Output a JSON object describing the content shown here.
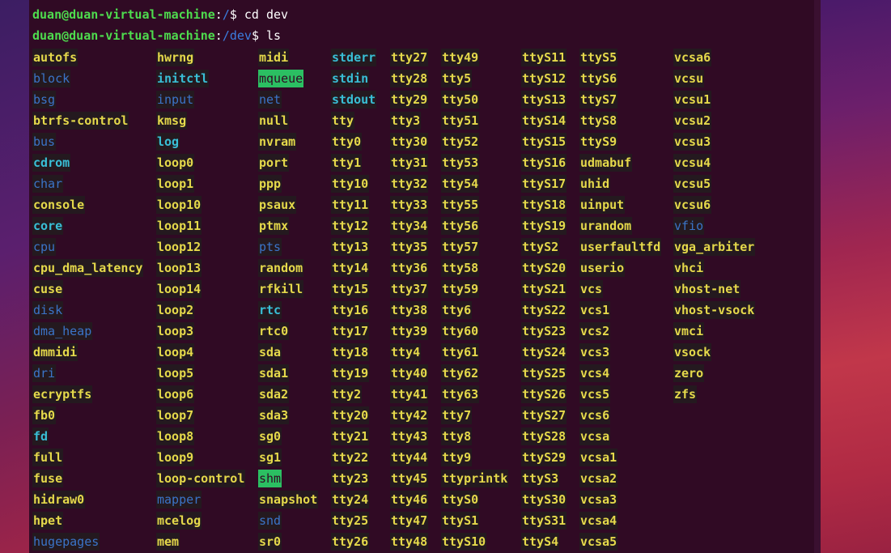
{
  "prompt": {
    "user_host": "duan@duan-virtual-machine",
    "line1_path": "/",
    "line1_cmd": "$ cd dev",
    "line2_path": "/dev",
    "line2_cmd": "$ ls"
  },
  "colors": {
    "terminal_bg": "#300a24",
    "char_device": "#e5d94b",
    "directory": "#3b74c8",
    "symlink": "#39bfd6",
    "sticky_dir_bg": "#2bbf62",
    "prompt_user": "#4edc4e",
    "prompt_path": "#3b7de0"
  },
  "listing": {
    "columns": [
      [
        {
          "name": "autofs",
          "type": "chr"
        },
        {
          "name": "block",
          "type": "dir"
        },
        {
          "name": "bsg",
          "type": "dir"
        },
        {
          "name": "btrfs-control",
          "type": "chr"
        },
        {
          "name": "bus",
          "type": "dir"
        },
        {
          "name": "cdrom",
          "type": "lnk"
        },
        {
          "name": "char",
          "type": "dir"
        },
        {
          "name": "console",
          "type": "chr"
        },
        {
          "name": "core",
          "type": "lnk"
        },
        {
          "name": "cpu",
          "type": "dir"
        },
        {
          "name": "cpu_dma_latency",
          "type": "chr"
        },
        {
          "name": "cuse",
          "type": "chr"
        },
        {
          "name": "disk",
          "type": "dir"
        },
        {
          "name": "dma_heap",
          "type": "dir"
        },
        {
          "name": "dmmidi",
          "type": "chr"
        },
        {
          "name": "dri",
          "type": "dir"
        },
        {
          "name": "ecryptfs",
          "type": "chr"
        },
        {
          "name": "fb0",
          "type": "chr"
        },
        {
          "name": "fd",
          "type": "lnk"
        },
        {
          "name": "full",
          "type": "chr"
        },
        {
          "name": "fuse",
          "type": "chr"
        },
        {
          "name": "hidraw0",
          "type": "chr"
        },
        {
          "name": "hpet",
          "type": "chr"
        },
        {
          "name": "hugepages",
          "type": "dir"
        }
      ],
      [
        {
          "name": "hwrng",
          "type": "chr"
        },
        {
          "name": "initctl",
          "type": "lnk"
        },
        {
          "name": "input",
          "type": "dir"
        },
        {
          "name": "kmsg",
          "type": "chr"
        },
        {
          "name": "log",
          "type": "lnk"
        },
        {
          "name": "loop0",
          "type": "chr"
        },
        {
          "name": "loop1",
          "type": "chr"
        },
        {
          "name": "loop10",
          "type": "chr"
        },
        {
          "name": "loop11",
          "type": "chr"
        },
        {
          "name": "loop12",
          "type": "chr"
        },
        {
          "name": "loop13",
          "type": "chr"
        },
        {
          "name": "loop14",
          "type": "chr"
        },
        {
          "name": "loop2",
          "type": "chr"
        },
        {
          "name": "loop3",
          "type": "chr"
        },
        {
          "name": "loop4",
          "type": "chr"
        },
        {
          "name": "loop5",
          "type": "chr"
        },
        {
          "name": "loop6",
          "type": "chr"
        },
        {
          "name": "loop7",
          "type": "chr"
        },
        {
          "name": "loop8",
          "type": "chr"
        },
        {
          "name": "loop9",
          "type": "chr"
        },
        {
          "name": "loop-control",
          "type": "chr"
        },
        {
          "name": "mapper",
          "type": "dir"
        },
        {
          "name": "mcelog",
          "type": "chr"
        },
        {
          "name": "mem",
          "type": "chr"
        }
      ],
      [
        {
          "name": "midi",
          "type": "chr"
        },
        {
          "name": "mqueue",
          "type": "sticky"
        },
        {
          "name": "net",
          "type": "dir"
        },
        {
          "name": "null",
          "type": "chr"
        },
        {
          "name": "nvram",
          "type": "chr"
        },
        {
          "name": "port",
          "type": "chr"
        },
        {
          "name": "ppp",
          "type": "chr"
        },
        {
          "name": "psaux",
          "type": "chr"
        },
        {
          "name": "ptmx",
          "type": "chr"
        },
        {
          "name": "pts",
          "type": "dir"
        },
        {
          "name": "random",
          "type": "chr"
        },
        {
          "name": "rfkill",
          "type": "chr"
        },
        {
          "name": "rtc",
          "type": "lnk"
        },
        {
          "name": "rtc0",
          "type": "chr"
        },
        {
          "name": "sda",
          "type": "chr"
        },
        {
          "name": "sda1",
          "type": "chr"
        },
        {
          "name": "sda2",
          "type": "chr"
        },
        {
          "name": "sda3",
          "type": "chr"
        },
        {
          "name": "sg0",
          "type": "chr"
        },
        {
          "name": "sg1",
          "type": "chr"
        },
        {
          "name": "shm",
          "type": "sticky"
        },
        {
          "name": "snapshot",
          "type": "chr"
        },
        {
          "name": "snd",
          "type": "dir"
        },
        {
          "name": "sr0",
          "type": "chr"
        }
      ],
      [
        {
          "name": "stderr",
          "type": "lnk"
        },
        {
          "name": "stdin",
          "type": "lnk"
        },
        {
          "name": "stdout",
          "type": "lnk"
        },
        {
          "name": "tty",
          "type": "chr"
        },
        {
          "name": "tty0",
          "type": "chr"
        },
        {
          "name": "tty1",
          "type": "chr"
        },
        {
          "name": "tty10",
          "type": "chr"
        },
        {
          "name": "tty11",
          "type": "chr"
        },
        {
          "name": "tty12",
          "type": "chr"
        },
        {
          "name": "tty13",
          "type": "chr"
        },
        {
          "name": "tty14",
          "type": "chr"
        },
        {
          "name": "tty15",
          "type": "chr"
        },
        {
          "name": "tty16",
          "type": "chr"
        },
        {
          "name": "tty17",
          "type": "chr"
        },
        {
          "name": "tty18",
          "type": "chr"
        },
        {
          "name": "tty19",
          "type": "chr"
        },
        {
          "name": "tty2",
          "type": "chr"
        },
        {
          "name": "tty20",
          "type": "chr"
        },
        {
          "name": "tty21",
          "type": "chr"
        },
        {
          "name": "tty22",
          "type": "chr"
        },
        {
          "name": "tty23",
          "type": "chr"
        },
        {
          "name": "tty24",
          "type": "chr"
        },
        {
          "name": "tty25",
          "type": "chr"
        },
        {
          "name": "tty26",
          "type": "chr"
        }
      ],
      [
        {
          "name": "tty27",
          "type": "chr"
        },
        {
          "name": "tty28",
          "type": "chr"
        },
        {
          "name": "tty29",
          "type": "chr"
        },
        {
          "name": "tty3",
          "type": "chr"
        },
        {
          "name": "tty30",
          "type": "chr"
        },
        {
          "name": "tty31",
          "type": "chr"
        },
        {
          "name": "tty32",
          "type": "chr"
        },
        {
          "name": "tty33",
          "type": "chr"
        },
        {
          "name": "tty34",
          "type": "chr"
        },
        {
          "name": "tty35",
          "type": "chr"
        },
        {
          "name": "tty36",
          "type": "chr"
        },
        {
          "name": "tty37",
          "type": "chr"
        },
        {
          "name": "tty38",
          "type": "chr"
        },
        {
          "name": "tty39",
          "type": "chr"
        },
        {
          "name": "tty4",
          "type": "chr"
        },
        {
          "name": "tty40",
          "type": "chr"
        },
        {
          "name": "tty41",
          "type": "chr"
        },
        {
          "name": "tty42",
          "type": "chr"
        },
        {
          "name": "tty43",
          "type": "chr"
        },
        {
          "name": "tty44",
          "type": "chr"
        },
        {
          "name": "tty45",
          "type": "chr"
        },
        {
          "name": "tty46",
          "type": "chr"
        },
        {
          "name": "tty47",
          "type": "chr"
        },
        {
          "name": "tty48",
          "type": "chr"
        }
      ],
      [
        {
          "name": "tty49",
          "type": "chr"
        },
        {
          "name": "tty5",
          "type": "chr"
        },
        {
          "name": "tty50",
          "type": "chr"
        },
        {
          "name": "tty51",
          "type": "chr"
        },
        {
          "name": "tty52",
          "type": "chr"
        },
        {
          "name": "tty53",
          "type": "chr"
        },
        {
          "name": "tty54",
          "type": "chr"
        },
        {
          "name": "tty55",
          "type": "chr"
        },
        {
          "name": "tty56",
          "type": "chr"
        },
        {
          "name": "tty57",
          "type": "chr"
        },
        {
          "name": "tty58",
          "type": "chr"
        },
        {
          "name": "tty59",
          "type": "chr"
        },
        {
          "name": "tty6",
          "type": "chr"
        },
        {
          "name": "tty60",
          "type": "chr"
        },
        {
          "name": "tty61",
          "type": "chr"
        },
        {
          "name": "tty62",
          "type": "chr"
        },
        {
          "name": "tty63",
          "type": "chr"
        },
        {
          "name": "tty7",
          "type": "chr"
        },
        {
          "name": "tty8",
          "type": "chr"
        },
        {
          "name": "tty9",
          "type": "chr"
        },
        {
          "name": "ttyprintk",
          "type": "chr"
        },
        {
          "name": "ttyS0",
          "type": "chr"
        },
        {
          "name": "ttyS1",
          "type": "chr"
        },
        {
          "name": "ttyS10",
          "type": "chr"
        }
      ],
      [
        {
          "name": "ttyS11",
          "type": "chr"
        },
        {
          "name": "ttyS12",
          "type": "chr"
        },
        {
          "name": "ttyS13",
          "type": "chr"
        },
        {
          "name": "ttyS14",
          "type": "chr"
        },
        {
          "name": "ttyS15",
          "type": "chr"
        },
        {
          "name": "ttyS16",
          "type": "chr"
        },
        {
          "name": "ttyS17",
          "type": "chr"
        },
        {
          "name": "ttyS18",
          "type": "chr"
        },
        {
          "name": "ttyS19",
          "type": "chr"
        },
        {
          "name": "ttyS2",
          "type": "chr"
        },
        {
          "name": "ttyS20",
          "type": "chr"
        },
        {
          "name": "ttyS21",
          "type": "chr"
        },
        {
          "name": "ttyS22",
          "type": "chr"
        },
        {
          "name": "ttyS23",
          "type": "chr"
        },
        {
          "name": "ttyS24",
          "type": "chr"
        },
        {
          "name": "ttyS25",
          "type": "chr"
        },
        {
          "name": "ttyS26",
          "type": "chr"
        },
        {
          "name": "ttyS27",
          "type": "chr"
        },
        {
          "name": "ttyS28",
          "type": "chr"
        },
        {
          "name": "ttyS29",
          "type": "chr"
        },
        {
          "name": "ttyS3",
          "type": "chr"
        },
        {
          "name": "ttyS30",
          "type": "chr"
        },
        {
          "name": "ttyS31",
          "type": "chr"
        },
        {
          "name": "ttyS4",
          "type": "chr"
        }
      ],
      [
        {
          "name": "ttyS5",
          "type": "chr"
        },
        {
          "name": "ttyS6",
          "type": "chr"
        },
        {
          "name": "ttyS7",
          "type": "chr"
        },
        {
          "name": "ttyS8",
          "type": "chr"
        },
        {
          "name": "ttyS9",
          "type": "chr"
        },
        {
          "name": "udmabuf",
          "type": "chr"
        },
        {
          "name": "uhid",
          "type": "chr"
        },
        {
          "name": "uinput",
          "type": "chr"
        },
        {
          "name": "urandom",
          "type": "chr"
        },
        {
          "name": "userfaultfd",
          "type": "chr"
        },
        {
          "name": "userio",
          "type": "chr"
        },
        {
          "name": "vcs",
          "type": "chr"
        },
        {
          "name": "vcs1",
          "type": "chr"
        },
        {
          "name": "vcs2",
          "type": "chr"
        },
        {
          "name": "vcs3",
          "type": "chr"
        },
        {
          "name": "vcs4",
          "type": "chr"
        },
        {
          "name": "vcs5",
          "type": "chr"
        },
        {
          "name": "vcs6",
          "type": "chr"
        },
        {
          "name": "vcsa",
          "type": "chr"
        },
        {
          "name": "vcsa1",
          "type": "chr"
        },
        {
          "name": "vcsa2",
          "type": "chr"
        },
        {
          "name": "vcsa3",
          "type": "chr"
        },
        {
          "name": "vcsa4",
          "type": "chr"
        },
        {
          "name": "vcsa5",
          "type": "chr"
        }
      ],
      [
        {
          "name": "vcsa6",
          "type": "chr"
        },
        {
          "name": "vcsu",
          "type": "chr"
        },
        {
          "name": "vcsu1",
          "type": "chr"
        },
        {
          "name": "vcsu2",
          "type": "chr"
        },
        {
          "name": "vcsu3",
          "type": "chr"
        },
        {
          "name": "vcsu4",
          "type": "chr"
        },
        {
          "name": "vcsu5",
          "type": "chr"
        },
        {
          "name": "vcsu6",
          "type": "chr"
        },
        {
          "name": "vfio",
          "type": "dir"
        },
        {
          "name": "vga_arbiter",
          "type": "chr"
        },
        {
          "name": "vhci",
          "type": "chr"
        },
        {
          "name": "vhost-net",
          "type": "chr"
        },
        {
          "name": "vhost-vsock",
          "type": "chr"
        },
        {
          "name": "vmci",
          "type": "chr"
        },
        {
          "name": "vsock",
          "type": "chr"
        },
        {
          "name": "zero",
          "type": "chr"
        },
        {
          "name": "zfs",
          "type": "chr"
        }
      ]
    ]
  }
}
